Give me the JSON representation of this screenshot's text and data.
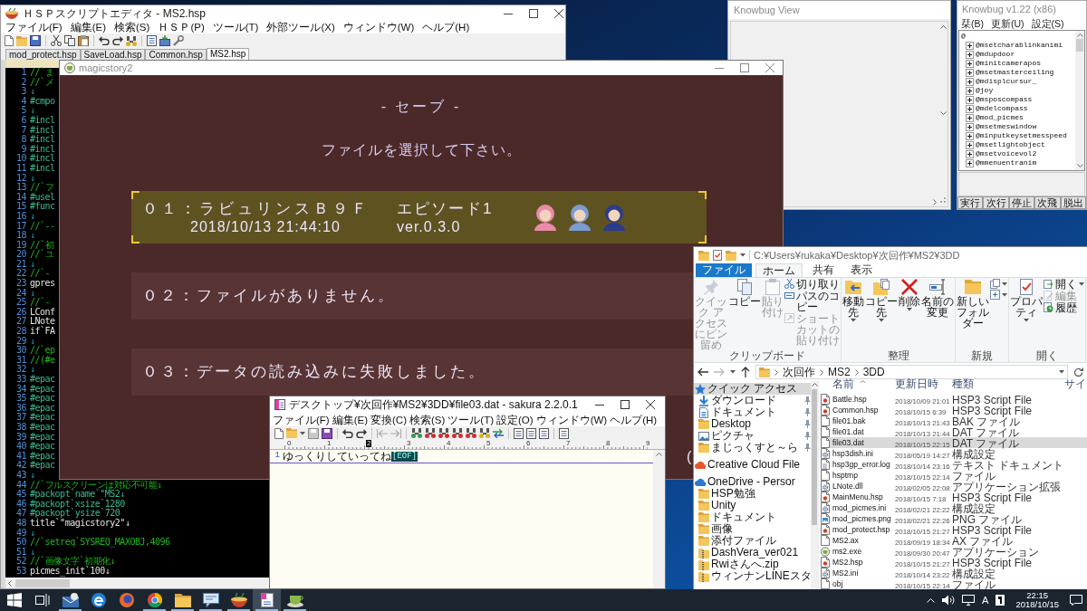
{
  "editor": {
    "title": "ＨＳＰスクリプトエディタ - MS2.hsp",
    "menu": [
      "ファイル(F)",
      "編集(E)",
      "検索(S)",
      "ＨＳＰ(P)",
      "ツール(T)",
      "外部ツール(X)",
      "ウィンドウ(W)",
      "ヘルプ(H)"
    ],
    "tabs": [
      {
        "label": "mod_protect.hsp",
        "selected": false
      },
      {
        "label": "SaveLoad.hsp",
        "selected": false
      },
      {
        "label": "Common.hsp",
        "selected": false
      },
      {
        "label": "MS2.hsp",
        "selected": true
      }
    ],
    "lines": [
      {
        "number": "1",
        "text": "//`ま",
        "kind": "comment"
      },
      {
        "number": "2",
        "text": "//`メ",
        "kind": "comment"
      },
      {
        "number": "3",
        "text": "↓",
        "kind": "newline"
      },
      {
        "number": "4",
        "text": "#cmpo",
        "kind": "directive"
      },
      {
        "number": "5",
        "text": "↓",
        "kind": "newline"
      },
      {
        "number": "6",
        "text": "#incl",
        "kind": "directive"
      },
      {
        "number": "7",
        "text": "#incl",
        "kind": "directive"
      },
      {
        "number": "8",
        "text": "#incl",
        "kind": "directive"
      },
      {
        "number": "9",
        "text": "#incl",
        "kind": "directive"
      },
      {
        "number": "10",
        "text": "#incl",
        "kind": "directive"
      },
      {
        "number": "11",
        "text": "#incl",
        "kind": "directive"
      },
      {
        "number": "12",
        "text": "↓",
        "kind": "newline"
      },
      {
        "number": "13",
        "text": "//`フ",
        "kind": "comment"
      },
      {
        "number": "14",
        "text": "#usel",
        "kind": "directive"
      },
      {
        "number": "15",
        "text": "#func",
        "kind": "directive"
      },
      {
        "number": "16",
        "text": "↓",
        "kind": "newline"
      },
      {
        "number": "17",
        "text": "//`--",
        "kind": "comment"
      },
      {
        "number": "18",
        "text": "↓",
        "kind": "newline"
      },
      {
        "number": "19",
        "text": "//`初",
        "kind": "comment"
      },
      {
        "number": "20",
        "text": "//`ユ",
        "kind": "comment"
      },
      {
        "number": "21",
        "text": "↓",
        "kind": "newline"
      },
      {
        "number": "22",
        "text": "//`-",
        "kind": "comment"
      },
      {
        "number": "23",
        "text": "gpres",
        "kind": "code"
      },
      {
        "number": "24",
        "text": "↓",
        "kind": "newline"
      },
      {
        "number": "25",
        "text": "//`-",
        "kind": "comment"
      },
      {
        "number": "26",
        "text": "LConf",
        "kind": "code"
      },
      {
        "number": "27",
        "text": "LNote",
        "kind": "code"
      },
      {
        "number": "28",
        "text": "if`FA",
        "kind": "code"
      },
      {
        "number": "29",
        "text": "↓",
        "kind": "newline"
      },
      {
        "number": "30",
        "text": "//`ep",
        "kind": "comment"
      },
      {
        "number": "31",
        "text": "//(#e",
        "kind": "comment"
      },
      {
        "number": "32",
        "text": "↓",
        "kind": "newline"
      },
      {
        "number": "33",
        "text": "#epac",
        "kind": "directive"
      },
      {
        "number": "34",
        "text": "#epac",
        "kind": "directive"
      },
      {
        "number": "35",
        "text": "#epac",
        "kind": "directive"
      },
      {
        "number": "36",
        "text": "#epac",
        "kind": "directive"
      },
      {
        "number": "37",
        "text": "#epac",
        "kind": "directive"
      },
      {
        "number": "38",
        "text": "#epac",
        "kind": "directive"
      },
      {
        "number": "39",
        "text": "#epac",
        "kind": "directive"
      },
      {
        "number": "40",
        "text": "#epac",
        "kind": "directive"
      },
      {
        "number": "41",
        "text": "#epac",
        "kind": "directive"
      },
      {
        "number": "42",
        "text": "#epac",
        "kind": "directive"
      },
      {
        "number": "43",
        "text": "↓",
        "kind": "newline"
      },
      {
        "number": "44",
        "text": "//`フルスクリーンは対応不可能↓",
        "kind": "comment"
      },
      {
        "number": "45",
        "text": "#packopt`name`\"MS2↓",
        "kind": "directive"
      },
      {
        "number": "46",
        "text": "#packopt`xsize`1280",
        "kind": "directive"
      },
      {
        "number": "47",
        "text": "#packopt`ysize`720",
        "kind": "directive"
      },
      {
        "number": "48",
        "text": "title`\"magicstory2\"↓",
        "kind": "code"
      },
      {
        "number": "49",
        "text": "↓",
        "kind": "newline"
      },
      {
        "number": "50",
        "text": "//`setreq`SYSREQ_MAXOBJ,4096",
        "kind": "comment"
      },
      {
        "number": "51",
        "text": "↓",
        "kind": "newline"
      },
      {
        "number": "52",
        "text": "//`画像文字`初期化↓",
        "kind": "comment"
      },
      {
        "number": "53",
        "text": "picmes_init`100↓",
        "kind": "code"
      }
    ]
  },
  "game_window": {
    "title": "magicstory2",
    "heading": "- セーブ -",
    "prompt": "ファイルを選択して下さい。",
    "slots": [
      {
        "kind": "save",
        "selected": true,
        "label": "０１：ラビュリンスＢ９Ｆ",
        "episode": "エピソード1",
        "timestamp": "2018/10/13 21:44:10",
        "version": "ver.0.3.0",
        "portraits": [
          {
            "color": "#e88aa8"
          },
          {
            "color": "#7c9cd0"
          },
          {
            "color": "#2c3c88"
          }
        ]
      },
      {
        "kind": "message",
        "selected": false,
        "label": "０２：ファイルがありません。"
      },
      {
        "kind": "message",
        "selected": false,
        "label": "０３：データの読み込みに失敗しました。"
      }
    ],
    "edge_text": "("
  },
  "knowbug_view": {
    "title": "Knowbug View"
  },
  "knowbug": {
    "title": "Knowbug v1.22 (x86)",
    "menu": [
      "栞(B)",
      "更新(U)",
      "設定(S)"
    ],
    "tree": [
      {
        "label": "@",
        "children": [
          {
            "label": "@msetcharablinkanimi",
            "expanded": false
          },
          {
            "label": "@mdupdoor",
            "expanded": false
          },
          {
            "label": "@minitcamerapos",
            "expanded": false
          },
          {
            "label": "@msetmasterceiling",
            "expanded": false
          },
          {
            "label": "@mdisplcursur_",
            "expanded": false
          },
          {
            "label": "@joy",
            "expanded": false
          },
          {
            "label": "@msposcompass",
            "expanded": false
          },
          {
            "label": "@mdelcompass",
            "expanded": false
          },
          {
            "label": "@mod_picmes",
            "expanded": false
          },
          {
            "label": "@msetmeswindow",
            "expanded": false
          },
          {
            "label": "@minputkeysetmesspeed",
            "expanded": false
          },
          {
            "label": "@msetlightobject",
            "expanded": false
          },
          {
            "label": "@msetvoicevol2",
            "expanded": false
          },
          {
            "label": "@mmenuentranim",
            "expanded": false
          }
        ]
      }
    ],
    "buttons": [
      "実行",
      "次行",
      "停止",
      "次飛",
      "脱出"
    ]
  },
  "explorer": {
    "title": "C:¥Users¥rukaka¥Desktop¥次回作¥MS2¥3DD",
    "tabs": [
      {
        "label": "ファイル",
        "kind": "backstage",
        "selected": false
      },
      {
        "label": "ホーム",
        "kind": "tab",
        "selected": true
      },
      {
        "label": "共有",
        "kind": "tab",
        "selected": false
      },
      {
        "label": "表示",
        "kind": "tab",
        "selected": false
      }
    ],
    "ribbon": [
      {
        "label": "クリップボード",
        "commands": [
          {
            "label": "クイック アクセスにピン留め",
            "kind": "large",
            "disabled": true,
            "menu": false
          },
          {
            "label": "コピー",
            "kind": "large",
            "disabled": false,
            "menu": false
          },
          {
            "label": "貼り付け",
            "kind": "large",
            "disabled": true,
            "menu": false
          },
          {
            "label": "切り取り",
            "kind": "small",
            "disabled": false,
            "menu": false
          },
          {
            "label": "パスのコピー",
            "kind": "small",
            "disabled": false,
            "menu": false
          },
          {
            "label": "ショートカットの貼り付け",
            "kind": "small",
            "disabled": true,
            "menu": false
          }
        ]
      },
      {
        "label": "整理",
        "commands": [
          {
            "label": "移動先",
            "kind": "large",
            "disabled": false,
            "menu": true
          },
          {
            "label": "コピー先",
            "kind": "large",
            "disabled": false,
            "menu": true
          },
          {
            "label": "削除",
            "kind": "large",
            "disabled": false,
            "menu": true
          },
          {
            "label": "名前の変更",
            "kind": "large",
            "disabled": false,
            "menu": false
          }
        ]
      },
      {
        "label": "新規",
        "commands": [
          {
            "label": "新しいフォルダー",
            "kind": "large",
            "disabled": false,
            "menu": false
          },
          {
            "kind": "small",
            "disabled": false,
            "menu": true
          },
          {
            "kind": "small",
            "disabled": false,
            "menu": true
          }
        ]
      },
      {
        "label": "開く",
        "commands": [
          {
            "label": "プロパティ",
            "kind": "large",
            "disabled": false,
            "menu": true
          },
          {
            "label": "開く",
            "kind": "small",
            "disabled": false,
            "menu": true
          },
          {
            "label": "編集",
            "kind": "small",
            "disabled": true,
            "menu": false
          },
          {
            "label": "履歴",
            "kind": "small",
            "disabled": false,
            "menu": false
          }
        ]
      }
    ],
    "address": {
      "crumbs": [
        "次回作",
        "MS2",
        "3DD"
      ]
    },
    "nav": [
      {
        "label": "クイック アクセス",
        "kind": "star",
        "selected": true,
        "children": [
          {
            "label": "ダウンロード",
            "kind": "download",
            "selected": false,
            "pinned": true
          },
          {
            "label": "ドキュメント",
            "kind": "documents",
            "selected": false,
            "pinned": true
          },
          {
            "label": "Desktop",
            "kind": "folder",
            "selected": false,
            "pinned": true
          },
          {
            "label": "ピクチャ",
            "kind": "pictures",
            "selected": false,
            "pinned": true
          },
          {
            "label": "まじっくすと～ら",
            "kind": "folder",
            "selected": false,
            "pinned": true
          }
        ]
      },
      {
        "label": "Creative Cloud File",
        "kind": "creative-cloud",
        "selected": false
      },
      {
        "label": "OneDrive - Persor",
        "kind": "onedrive",
        "selected": false,
        "children": [
          {
            "label": "HSP勉強",
            "kind": "folder",
            "selected": false
          },
          {
            "label": "Unity",
            "kind": "folder",
            "selected": false
          },
          {
            "label": "ドキュメント",
            "kind": "folder",
            "selected": false
          },
          {
            "label": "画像",
            "kind": "folder",
            "selected": false
          },
          {
            "label": "添付ファイル",
            "kind": "folder",
            "selected": false
          },
          {
            "label": "DashVera_ver021",
            "kind": "zip",
            "selected": false
          },
          {
            "label": "Rwiさんへ.zip",
            "kind": "zip",
            "selected": false
          },
          {
            "label": "ウィンナンLINEスタ",
            "kind": "zip",
            "selected": false
          }
        ]
      }
    ],
    "columns": [
      "名前",
      "更新日時",
      "種類",
      "サイ"
    ],
    "files": [
      {
        "name": "Battle.hsp",
        "modified": "2018/10/09 21:01",
        "type": "HSP3 Script File",
        "kind": "script",
        "selected": false
      },
      {
        "name": "Common.hsp",
        "modified": "2018/10/15 6:39",
        "type": "HSP3 Script File",
        "kind": "script",
        "selected": false
      },
      {
        "name": "file01.bak",
        "modified": "2018/10/13 21:43",
        "type": "BAK ファイル",
        "kind": "file",
        "selected": false
      },
      {
        "name": "file01.dat",
        "modified": "2018/10/13 21:44",
        "type": "DAT ファイル",
        "kind": "file",
        "selected": false
      },
      {
        "name": "file03.dat",
        "modified": "2018/10/15 22:15",
        "type": "DAT ファイル",
        "kind": "file",
        "selected": true
      },
      {
        "name": "hsp3dish.ini",
        "modified": "2018/05/19 14:27",
        "type": "構成設定",
        "kind": "config",
        "selected": false
      },
      {
        "name": "hsp3gp_error.log",
        "modified": "2018/10/14 23:16",
        "type": "テキスト ドキュメント",
        "kind": "text",
        "selected": false
      },
      {
        "name": "hsptmp",
        "modified": "2018/10/15 22:14",
        "type": "ファイル",
        "kind": "file",
        "selected": false
      },
      {
        "name": "LNote.dll",
        "modified": "2018/02/05 22:08",
        "type": "アプリケーション拡張",
        "kind": "library",
        "selected": false
      },
      {
        "name": "MainMenu.hsp",
        "modified": "2018/10/15 7:18",
        "type": "HSP3 Script File",
        "kind": "script",
        "selected": false
      },
      {
        "name": "mod_picmes.ini",
        "modified": "2018/02/21 22:22",
        "type": "構成設定",
        "kind": "config",
        "selected": false
      },
      {
        "name": "mod_picmes.png",
        "modified": "2018/02/21 22:26",
        "type": "PNG ファイル",
        "kind": "image",
        "selected": false
      },
      {
        "name": "mod_protect.hsp",
        "modified": "2018/10/15 21:27",
        "type": "HSP3 Script File",
        "kind": "script",
        "selected": false
      },
      {
        "name": "MS2.ax",
        "modified": "2018/09/19 18:34",
        "type": "AX ファイル",
        "kind": "file",
        "selected": false
      },
      {
        "name": "ms2.exe",
        "modified": "2018/09/30 20:47",
        "type": "アプリケーション",
        "kind": "app",
        "selected": false
      },
      {
        "name": "MS2.hsp",
        "modified": "2018/10/15 21:27",
        "type": "HSP3 Script File",
        "kind": "script",
        "selected": false
      },
      {
        "name": "MS2.ini",
        "modified": "2018/10/14 23:22",
        "type": "構成設定",
        "kind": "config",
        "selected": false
      },
      {
        "name": "obj",
        "modified": "2018/10/15 22:14",
        "type": "ファイル",
        "kind": "file",
        "selected": false
      }
    ]
  },
  "sakura": {
    "title": "デスクトップ¥次回作¥MS2¥3DD¥file03.dat - sakura 2.2.0.1",
    "menu": [
      "ファイル(F)",
      "編集(E)",
      "変換(C)",
      "検索(S)",
      "ツール(T)",
      "設定(O)",
      "ウィンドウ(W)",
      "ヘルプ(H)"
    ],
    "ruler": [
      {
        "label": "0",
        "current": false
      },
      {
        "label": "1",
        "current": false
      },
      {
        "label": "2",
        "current": true
      },
      {
        "label": "3",
        "current": false
      },
      {
        "label": "4",
        "current": false
      },
      {
        "label": "5",
        "current": false
      },
      {
        "label": "6",
        "current": false
      },
      {
        "label": "7",
        "current": false
      },
      {
        "label": "8",
        "current": false
      },
      {
        "label": "9",
        "current": false
      }
    ],
    "lines": [
      {
        "number": "1",
        "text": "ゆっくりしていってね",
        "eof": "[EOF]"
      }
    ]
  },
  "taskbar": {
    "apps": [
      {
        "kind": "start",
        "running": false,
        "selected": false
      },
      {
        "kind": "task-view",
        "running": false,
        "selected": false
      },
      {
        "kind": "mail",
        "running": true,
        "selected": false
      },
      {
        "kind": "browser-e",
        "running": false,
        "selected": false
      },
      {
        "kind": "browser-fox",
        "running": false,
        "selected": false
      },
      {
        "kind": "browser-ring",
        "running": true,
        "selected": false
      },
      {
        "kind": "files",
        "running": true,
        "selected": false
      },
      {
        "kind": "chat",
        "running": true,
        "selected": false
      },
      {
        "kind": "bowl",
        "running": true,
        "selected": false
      },
      {
        "kind": "notepad",
        "running": true,
        "selected": true
      },
      {
        "kind": "cup",
        "running": true,
        "selected": false
      }
    ],
    "ime": "A",
    "time": "22:15",
    "date": "2018/10/15"
  }
}
